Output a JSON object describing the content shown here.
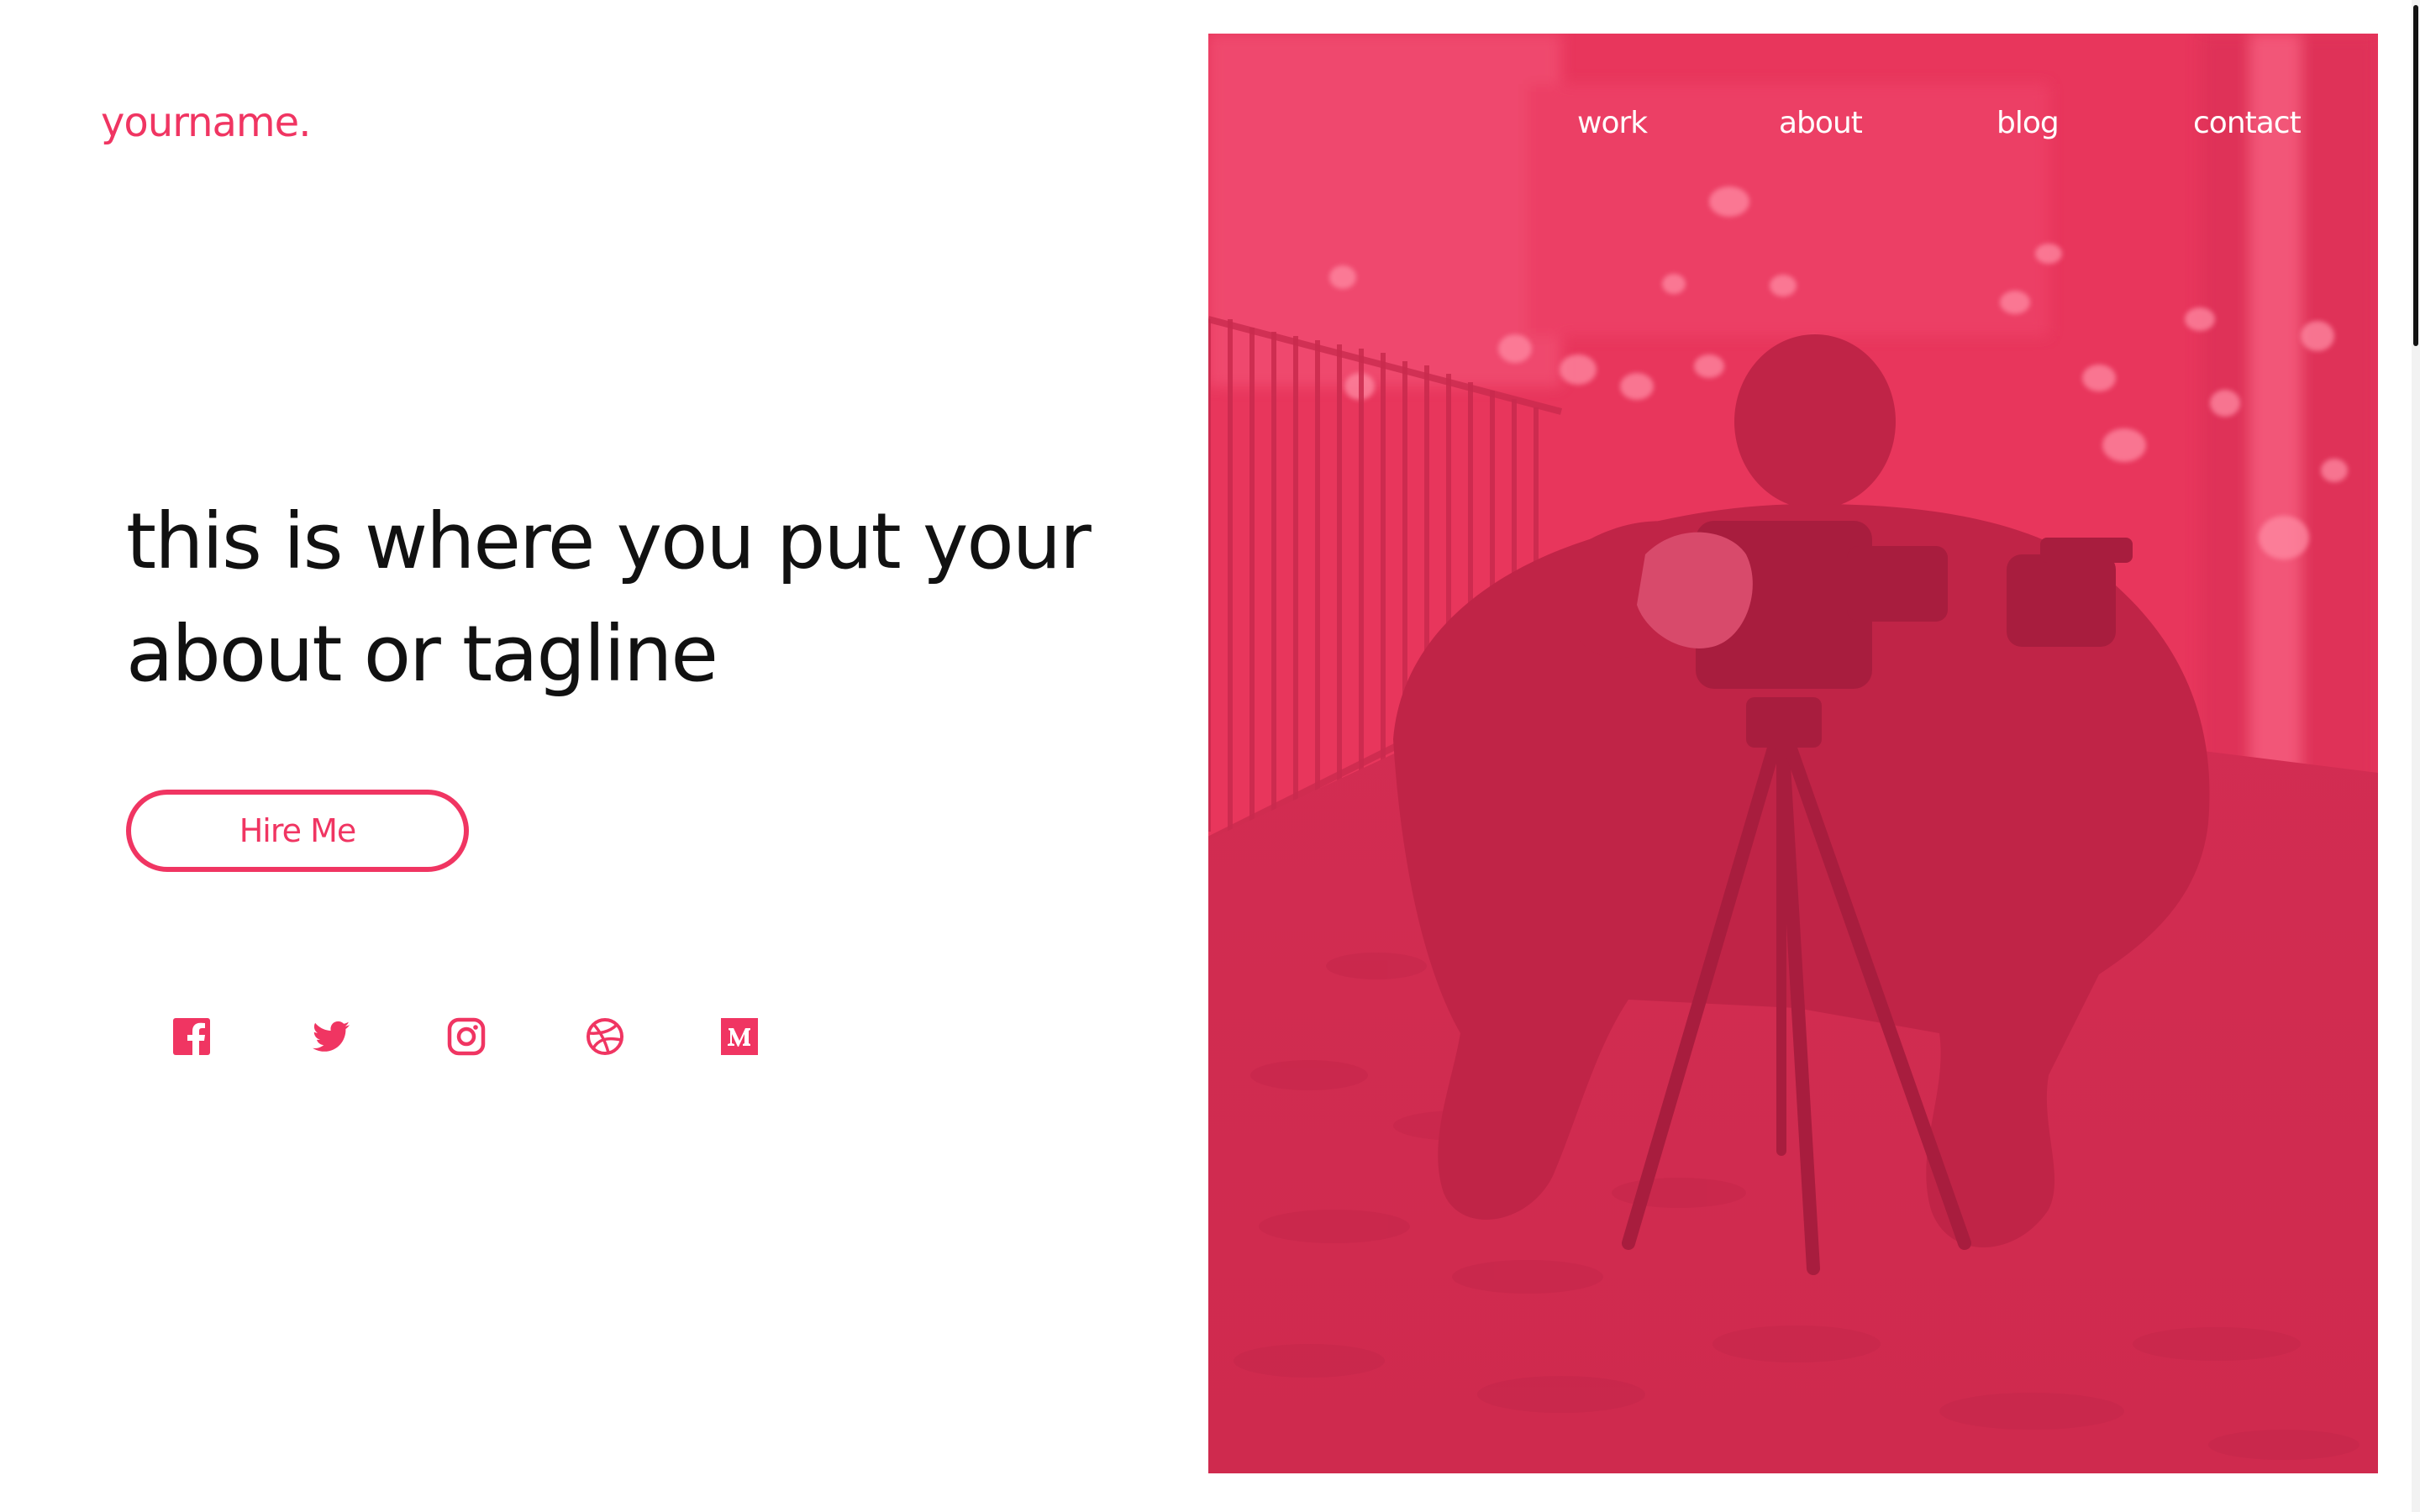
{
  "brand": {
    "logo_text": "yourname.",
    "accent_color": "#f03562",
    "overlay_color": "#e8325a"
  },
  "nav": {
    "items": [
      {
        "label": "work"
      },
      {
        "label": "about"
      },
      {
        "label": "blog"
      },
      {
        "label": "contact"
      }
    ],
    "color": "#ffffff"
  },
  "hero": {
    "tagline": "this is where you put your about or tagline",
    "cta_label": "Hire Me",
    "image_subject": "photographer crouching with camera on tripod, pink tint"
  },
  "socials": [
    {
      "icon": "facebook-icon"
    },
    {
      "icon": "twitter-icon"
    },
    {
      "icon": "instagram-icon"
    },
    {
      "icon": "dribbble-icon"
    },
    {
      "icon": "medium-icon"
    }
  ]
}
